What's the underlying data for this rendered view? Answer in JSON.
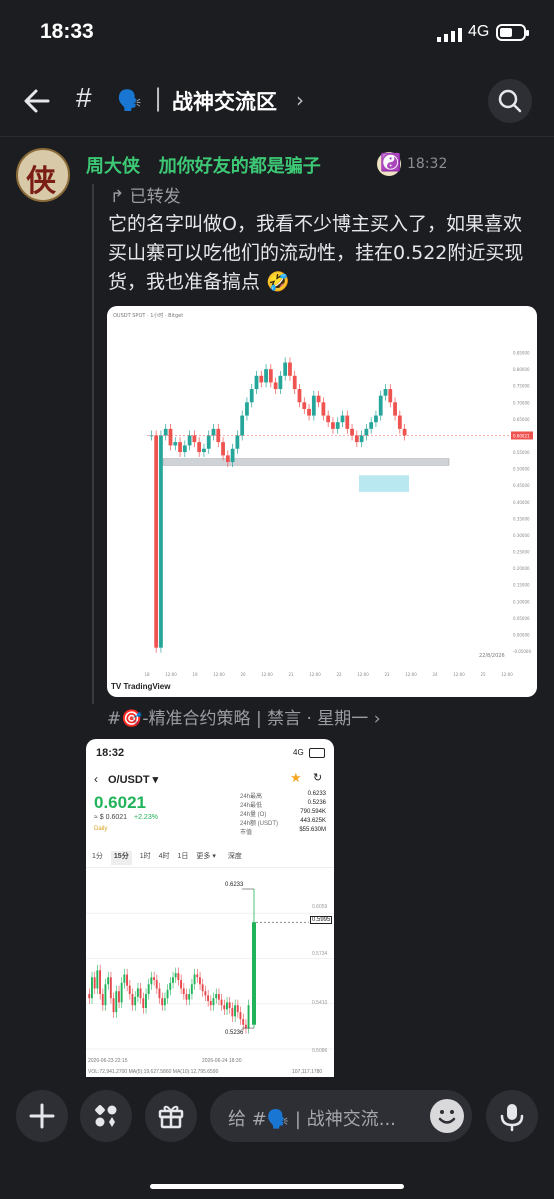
{
  "status_bar": {
    "time": "18:33",
    "network": "4G"
  },
  "header": {
    "hash": "#",
    "channel_emoji": "🗣️",
    "separator": "|",
    "channel_name": "战神交流区",
    "chevron": "›"
  },
  "message": {
    "author": "周大侠   加你好友的都是骗子",
    "avatar_char": "侠",
    "badge_emoji": "☯️",
    "time": "18:32",
    "forwarded_label": "↱ 已转发",
    "body": "它的名字叫做O，我看不少博主买入了，如果喜欢买山寨可以吃他们的流动性，挂在0.522附近买现货，我也准备搞点",
    "body_emoji": "🤣",
    "source": "#🎯-精准合约策略 | 禁言 · 星期一 ›"
  },
  "chart1": {
    "watermark": "TradingView",
    "pair_label": "OUSDT SPOT · 1小时 · Bitget",
    "current_price_tag": "0.60021",
    "date_label": "22/8/2026",
    "chart_data": {
      "type": "candlestick",
      "title": "",
      "ylim": [
        -0.05,
        0.9
      ],
      "yticks": [
        "0.85000",
        "0.80000",
        "0.75000",
        "0.70000",
        "0.65000",
        "0.60000",
        "0.55000",
        "0.50000",
        "0.45000",
        "0.40000",
        "0.35000",
        "0.30000",
        "0.25000",
        "0.20000",
        "0.15000",
        "0.10000",
        "0.05000",
        "0.00000",
        "-0.05000"
      ],
      "xticks": [
        "18",
        "12:00",
        "19",
        "12:00",
        "20",
        "12:00",
        "21",
        "12:00",
        "22",
        "12:00",
        "23",
        "12:00",
        "24",
        "12:00",
        "25",
        "12:00"
      ],
      "support_zone": [
        0.51,
        0.53
      ],
      "buy_zone": [
        0.43,
        0.48
      ]
    }
  },
  "phone2": {
    "time": "18:32",
    "network": "4G",
    "pair": "O/USDT ▾",
    "price": "0.6021",
    "fiat": "≈ $ 0.6021",
    "change": "+2.23%",
    "exchange": "Daily",
    "stats": [
      {
        "k": "24h最高",
        "v": "0.6233"
      },
      {
        "k": "24h最低",
        "v": "0.5236"
      },
      {
        "k": "24h量 (O)",
        "v": "790.594K"
      },
      {
        "k": "24h额 (USDT)",
        "v": "443.625K"
      },
      {
        "k": "市值",
        "v": "$55.630M"
      }
    ],
    "intervals": [
      "1分",
      "15分",
      "1时",
      "4时",
      "1日",
      "更多 ▾",
      "深度"
    ],
    "high_label": "0.6233",
    "low_label": "0.5236",
    "current_label": "0.5995",
    "right_ticks": [
      "0.6059",
      "0.5734",
      "0.5410",
      "0.5086"
    ],
    "date_left": "2026-06-23 22:15",
    "date_right": "2026-06-24 18:30",
    "vol_line": "VOL:72,941.2700  MA(5):19,627.5860  MA(10):12,795.6590",
    "vol_right": "107,117.1780",
    "chart_data": {
      "type": "candlestick",
      "title": "",
      "ylim": [
        0.5086,
        0.6233
      ],
      "high": 0.6233,
      "low": 0.5236,
      "last": 0.5995
    }
  },
  "composer": {
    "placeholder": "给 #🗣️ | 战神交流..."
  }
}
